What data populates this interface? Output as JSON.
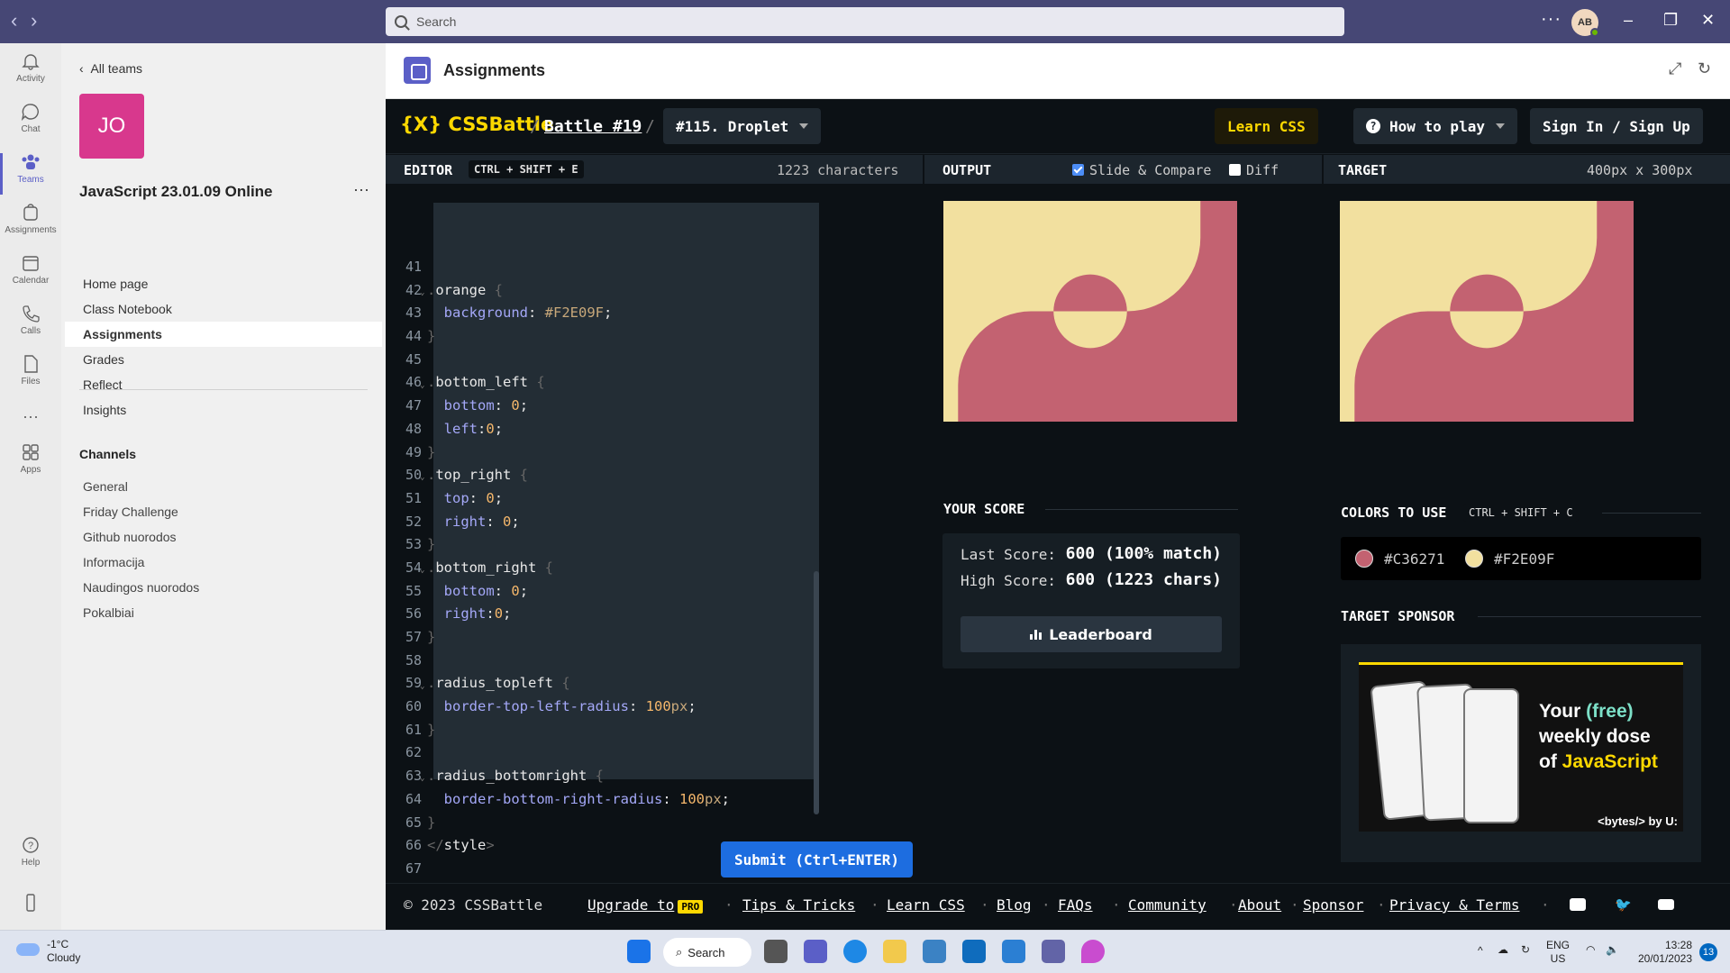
{
  "titlebar": {
    "search_placeholder": "Search",
    "avatar_initials": "AB"
  },
  "rail": [
    {
      "label": "Activity"
    },
    {
      "label": "Chat"
    },
    {
      "label": "Teams"
    },
    {
      "label": "Assignments"
    },
    {
      "label": "Calendar"
    },
    {
      "label": "Calls"
    },
    {
      "label": "Files"
    },
    {
      "label": "Apps"
    },
    {
      "label": "Help"
    }
  ],
  "team": {
    "back_label": "All teams",
    "initials": "JO",
    "name": "JavaScript 23.01.09 Online",
    "nav": [
      "Home page",
      "Class Notebook",
      "Assignments",
      "Grades",
      "Reflect",
      "Insights"
    ],
    "active_nav": "Assignments",
    "channels_title": "Channels",
    "channels": [
      "General",
      "Friday Challenge",
      "Github nuorodos",
      "Informacija",
      "Naudingos nuorodos",
      "Pokalbiai"
    ]
  },
  "assignments": {
    "title": "Assignments"
  },
  "cssbattle": {
    "logo": "{X} CSSBattle",
    "battle": "Battle #19",
    "target": "#115. Droplet",
    "learn_css": "Learn CSS",
    "how_to_play": "How to play",
    "sign_in": "Sign In / Sign Up",
    "editor": {
      "label": "EDITOR",
      "shortcut": "CTRL + SHIFT + E",
      "char_count": "1223 characters"
    },
    "output": {
      "label": "OUTPUT",
      "slide_compare": "Slide & Compare",
      "diff": "Diff"
    },
    "target_pane": {
      "label": "TARGET",
      "size": "400px x 300px"
    },
    "code_lines": [
      {
        "n": "41",
        "html": ""
      },
      {
        "n": "42",
        "fold": true,
        "html": "<span class='br'>.</span>orange <span class='br'>{</span>"
      },
      {
        "n": "43",
        "html": "  <span class='prop'>background</span>: <span class='str'>#F2E09F</span>;"
      },
      {
        "n": "44",
        "html": "<span class='br'>}</span>"
      },
      {
        "n": "45",
        "html": ""
      },
      {
        "n": "46",
        "fold": true,
        "html": "<span class='br'>.</span>bottom_left <span class='br'>{</span>"
      },
      {
        "n": "47",
        "html": "  <span class='prop'>bottom</span>: <span class='num'>0</span>;"
      },
      {
        "n": "48",
        "html": "  <span class='prop'>left</span>:<span class='num'>0</span>;"
      },
      {
        "n": "49",
        "html": "<span class='br'>}</span>"
      },
      {
        "n": "50",
        "fold": true,
        "html": "<span class='br'>.</span>top_right <span class='br'>{</span>"
      },
      {
        "n": "51",
        "html": "  <span class='prop'>top</span>: <span class='num'>0</span>;"
      },
      {
        "n": "52",
        "html": "  <span class='prop'>right</span>: <span class='num'>0</span>;"
      },
      {
        "n": "53",
        "html": "<span class='br'>}</span>"
      },
      {
        "n": "54",
        "fold": true,
        "html": "<span class='br'>.</span>bottom_right <span class='br'>{</span>"
      },
      {
        "n": "55",
        "html": "  <span class='prop'>bottom</span>: <span class='num'>0</span>;"
      },
      {
        "n": "56",
        "html": "  <span class='prop'>right</span>:<span class='num'>0</span>;"
      },
      {
        "n": "57",
        "html": "<span class='br'>}</span>"
      },
      {
        "n": "58",
        "html": ""
      },
      {
        "n": "59",
        "fold": true,
        "html": "<span class='br'>.</span>radius_topleft <span class='br'>{</span>"
      },
      {
        "n": "60",
        "html": "  <span class='prop'>border-top-left-radius</span>: <span class='num'>100</span><span class='str'>px</span>;"
      },
      {
        "n": "61",
        "html": "<span class='br'>}</span>"
      },
      {
        "n": "62",
        "html": ""
      },
      {
        "n": "63",
        "fold": true,
        "html": "<span class='br'>.</span>radius_bottomright <span class='br'>{</span>"
      },
      {
        "n": "64",
        "html": "  <span class='prop'>border-bottom-right-radius</span>: <span class='num'>100</span><span class='str'>px</span>;"
      },
      {
        "n": "65",
        "html": "<span class='br'>}</span>"
      },
      {
        "n": "66",
        "html": "<span class='br'>&lt;/</span>style<span class='br'>&gt;</span>"
      },
      {
        "n": "67",
        "html": ""
      }
    ],
    "submit": "Submit (Ctrl+ENTER)",
    "score": {
      "title": "YOUR SCORE",
      "last_label": "Last Score:",
      "last_value": "600 (100% match)",
      "high_label": "High Score:",
      "high_value": "600 (1223 chars)",
      "leaderboard": "Leaderboard"
    },
    "colors": {
      "title": "COLORS TO USE",
      "shortcut": "CTRL + SHIFT + C",
      "list": [
        {
          "hex": "#C36271",
          "label": "#C36271"
        },
        {
          "hex": "#F2E09F",
          "label": "#F2E09F"
        }
      ]
    },
    "sponsor": {
      "title": "TARGET SPONSOR",
      "line1a": "Your ",
      "line1b": "(free)",
      "line2": "weekly dose",
      "line3a": "of ",
      "line3b": "JavaScript",
      "brand": "<bytes/> by U:"
    },
    "footer": {
      "copyright": "© 2023 CSSBattle",
      "links": [
        "Upgrade to",
        "Tips & Tricks",
        "Learn CSS",
        "Blog",
        "FAQs",
        "Community",
        "About",
        "Sponsor",
        "Privacy & Terms"
      ],
      "pro_badge": "PRO"
    }
  },
  "taskbar": {
    "temp": "-1°C",
    "weather": "Cloudy",
    "search": "Search",
    "lang1": "ENG",
    "lang2": "US",
    "time": "13:28",
    "date": "20/01/2023",
    "notifications": "13"
  }
}
